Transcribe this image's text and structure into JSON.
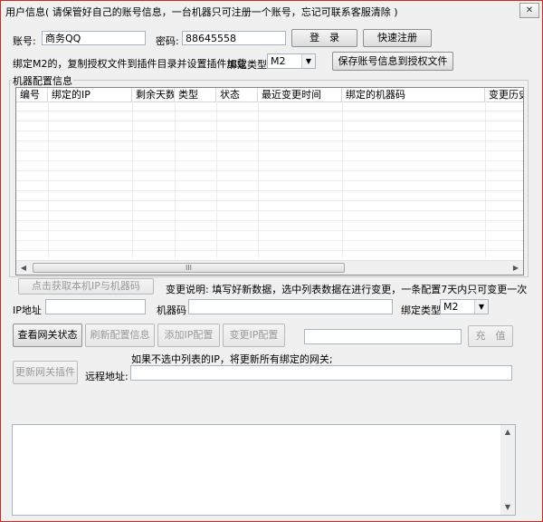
{
  "window": {
    "title": "用户信息( 请保管好自己的账号信息，一台机器只可注册一个账号，忘记可联系客服清除 )",
    "close_glyph": "✕"
  },
  "account": {
    "label": "账号:",
    "value": "商务QQ",
    "password_label": "密码:",
    "password_value": "88645558",
    "login_button": "登　录",
    "register_button": "快速注册"
  },
  "binding": {
    "hint": "绑定M2的，复制授权文件到插件目录并设置插件加载",
    "type_label": "绑定类型",
    "type_value": "M2",
    "save_button": "保存账号信息到授权文件"
  },
  "machine_config": {
    "group_title": "机器配置信息",
    "columns": [
      "编号",
      "绑定的IP",
      "剩余天数",
      "类型",
      "状态",
      "最近变更时间",
      "绑定的机器码",
      "变更历史"
    ],
    "rows": [],
    "scroll_grip": "III"
  },
  "actions": {
    "fetch_button": "点击获取本机IP与机器码",
    "change_note": "变更说明: 填写好新数据，选中列表数据在进行变更，一条配置7天内只可变更一次",
    "ip_label": "IP地址",
    "ip_value": "",
    "machine_label": "机器码",
    "machine_value": "",
    "bind_type_label": "绑定类型",
    "bind_type_value": "M2",
    "query_gateway_button": "查看网关状态",
    "refresh_button": "刷新配置信息",
    "add_ip_button": "添加IP配置",
    "change_ip_button": "变更IP配置",
    "recharge_value": "",
    "recharge_button": "充　值",
    "update_plugin_button": "更新网关插件",
    "update_note": "如果不选中列表的IP，将更新所有绑定的网关;",
    "remote_label": "远程地址:",
    "remote_value": ""
  },
  "log": {
    "text": ""
  }
}
